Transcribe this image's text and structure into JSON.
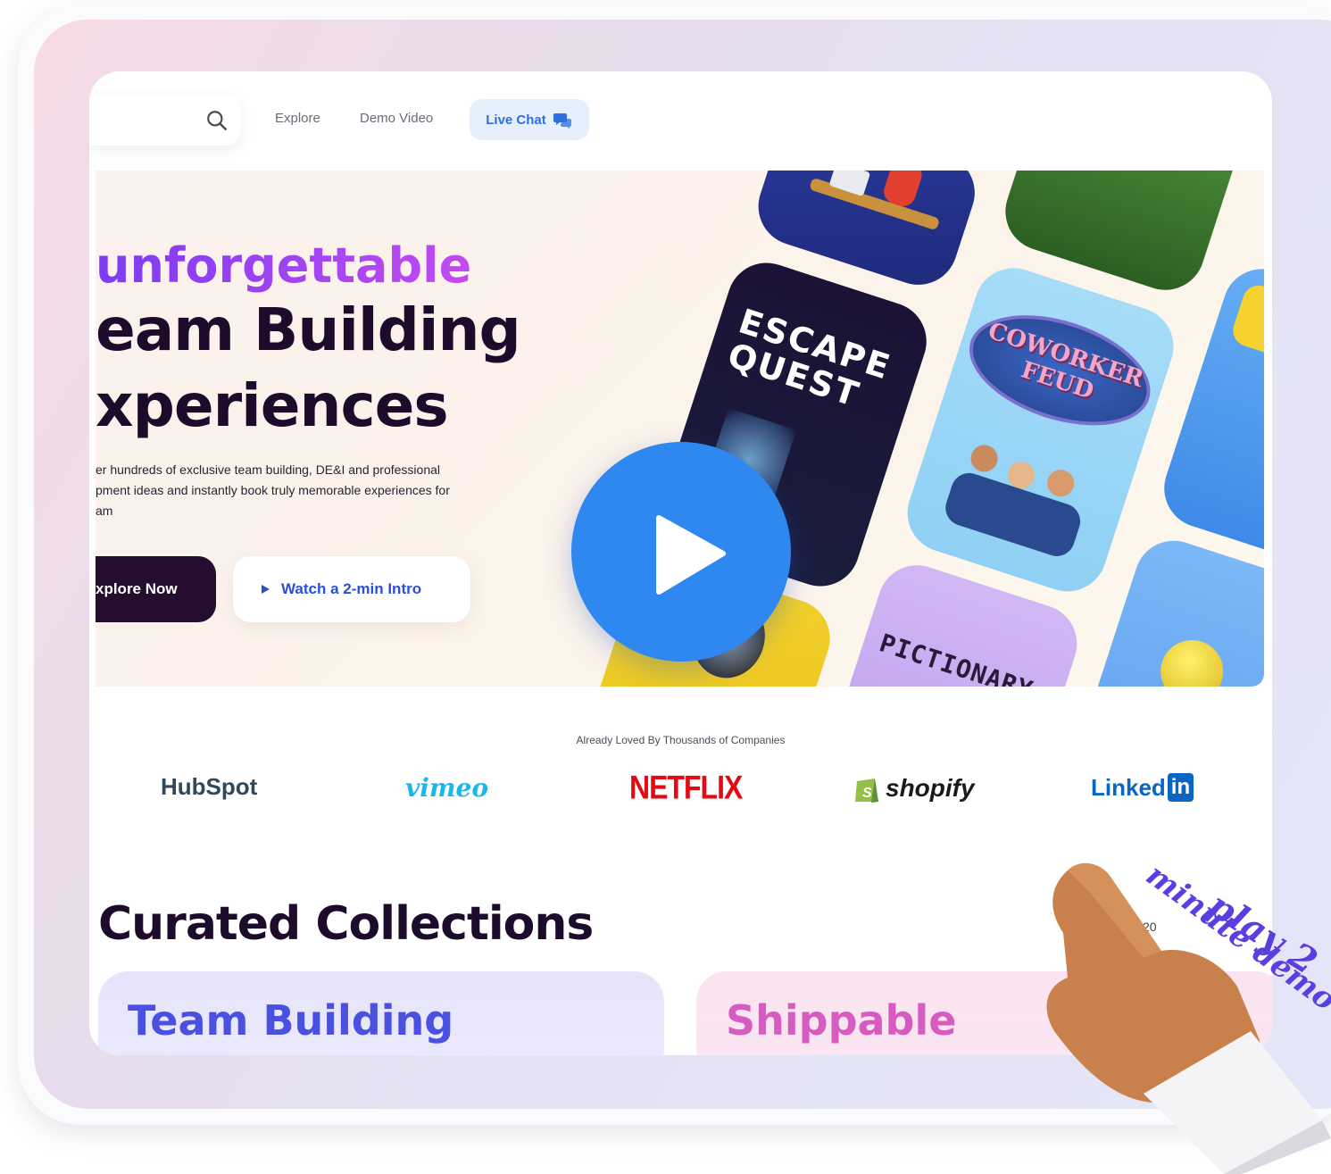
{
  "nav": {
    "explore": "Explore",
    "demo_video": "Demo Video",
    "live_chat": "Live Chat"
  },
  "hero": {
    "line1": "unforgettable",
    "line2": "eam Building",
    "line3": "xperiences",
    "description": [
      "er hundreds of exclusive team building, DE&I and professional",
      "pment ideas and instantly book truly memorable experiences for",
      "am"
    ],
    "explore_button": "xplore Now",
    "watch_button": "Watch a 2-min Intro",
    "cards": {
      "escape_quest": [
        "ESCAPE",
        "QUEST"
      ],
      "coworker_feud": [
        "COWORKER",
        "FEUD"
      ],
      "pictionary": "PICTIONARY"
    }
  },
  "logos": {
    "caption": "Already Loved By Thousands of Companies",
    "items": [
      "HubSpot",
      "vimeo",
      "NETFLIX",
      "shopify",
      "Linked"
    ],
    "linkedin_badge": "in"
  },
  "collections": {
    "title": "Curated Collections",
    "pager": "20",
    "cards": [
      "Team Building",
      "Shippable"
    ]
  },
  "annotation": {
    "line1": "play 2",
    "line2": "minute demo"
  },
  "colors": {
    "accent_blue": "#2f88f0",
    "dark": "#1d0b2b",
    "purple_gradient_start": "#7b3cf4",
    "purple_gradient_end": "#c24bf0",
    "netflix_red": "#e50914",
    "vimeo_blue": "#1ab7ea",
    "shopify_green": "#95bf47",
    "linkedin_blue": "#0a66c2",
    "hubspot_orange": "#ff7a59"
  }
}
